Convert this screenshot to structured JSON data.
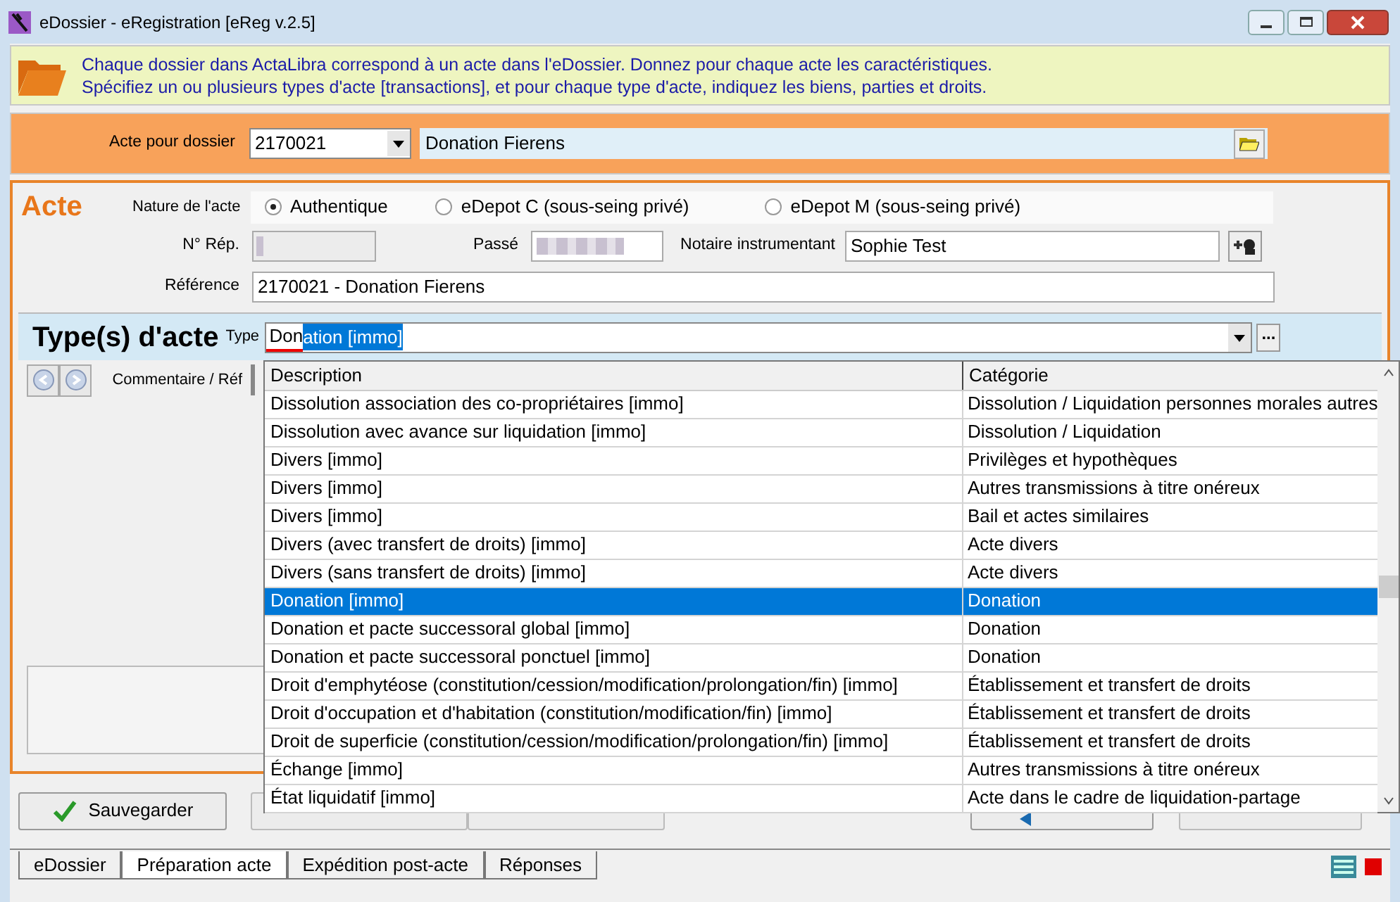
{
  "window": {
    "title": "eDossier - eRegistration [eReg v.2.5]"
  },
  "banner": {
    "lines": [
      "Chaque dossier dans ActaLibra correspond à un acte dans l'eDossier.  Donnez pour chaque acte les caractéristiques.",
      "Spécifiez un ou plusieurs types d'acte [transactions], et pour chaque type d'acte, indiquez les biens, parties et droits."
    ]
  },
  "dossier": {
    "label": "Acte pour dossier",
    "number": "2170021",
    "name": "Donation Fierens"
  },
  "acte": {
    "title": "Acte",
    "nature_label": "Nature de l'acte",
    "nature_options": [
      {
        "label": "Authentique",
        "selected": true
      },
      {
        "label": "eDepot C (sous-seing privé)",
        "selected": false
      },
      {
        "label": "eDepot M (sous-seing privé)",
        "selected": false
      }
    ],
    "rep_label": "N° Rép.",
    "passe_label": "Passé",
    "notaire_label": "Notaire instrumentant",
    "notaire": "Sophie Test",
    "reference_label": "Référence",
    "reference": "2170021 - Donation Fierens"
  },
  "types": {
    "title": "Type(s) d'acte",
    "type_label": "Type",
    "typed_text": "Don",
    "autocomplete_text": "ation [immo]",
    "more_button": "...",
    "comment_label": "Commentaire / Réf"
  },
  "dropdown": {
    "columns": [
      "Description",
      "Catégorie"
    ],
    "rows": [
      {
        "description": "Dissolution association des co-propriétaires [immo]",
        "category": "Dissolution / Liquidation personnes morales autres",
        "selected": false
      },
      {
        "description": "Dissolution avec avance sur liquidation [immo]",
        "category": "Dissolution / Liquidation",
        "selected": false
      },
      {
        "description": "Divers [immo]",
        "category": "Privilèges et hypothèques",
        "selected": false
      },
      {
        "description": "Divers [immo]",
        "category": "Autres transmissions à titre onéreux",
        "selected": false
      },
      {
        "description": "Divers [immo]",
        "category": "Bail et actes similaires",
        "selected": false
      },
      {
        "description": "Divers (avec transfert de droits) [immo]",
        "category": "Acte divers",
        "selected": false
      },
      {
        "description": "Divers (sans transfert de droits) [immo]",
        "category": "Acte divers",
        "selected": false
      },
      {
        "description": "Donation [immo]",
        "category": "Donation",
        "selected": true
      },
      {
        "description": "Donation et pacte successoral global [immo]",
        "category": "Donation",
        "selected": false
      },
      {
        "description": "Donation et pacte successoral ponctuel [immo]",
        "category": "Donation",
        "selected": false
      },
      {
        "description": "Droit d'emphytéose (constitution/cession/modification/prolongation/fin) [immo]",
        "category": "Établissement et transfert de droits",
        "selected": false
      },
      {
        "description": "Droit d'occupation et d'habitation (constitution/modification/fin) [immo]",
        "category": "Établissement et transfert de droits",
        "selected": false
      },
      {
        "description": "Droit de superficie (constitution/cession/modification/prolongation/fin) [immo]",
        "category": "Établissement et transfert de droits",
        "selected": false
      },
      {
        "description": "Échange [immo]",
        "category": "Autres transmissions à titre onéreux",
        "selected": false
      },
      {
        "description": "État liquidatif [immo]",
        "category": "Acte dans le cadre de liquidation-partage",
        "selected": false
      }
    ]
  },
  "actions": [
    {
      "kind": "button",
      "label": "Sauvegarder"
    }
  ],
  "tabs": [
    {
      "label": "eDossier",
      "selected": false
    },
    {
      "label": "Préparation acte",
      "selected": true
    },
    {
      "label": "Expédition post-acte",
      "selected": false
    },
    {
      "label": "Réponses",
      "selected": false
    }
  ]
}
